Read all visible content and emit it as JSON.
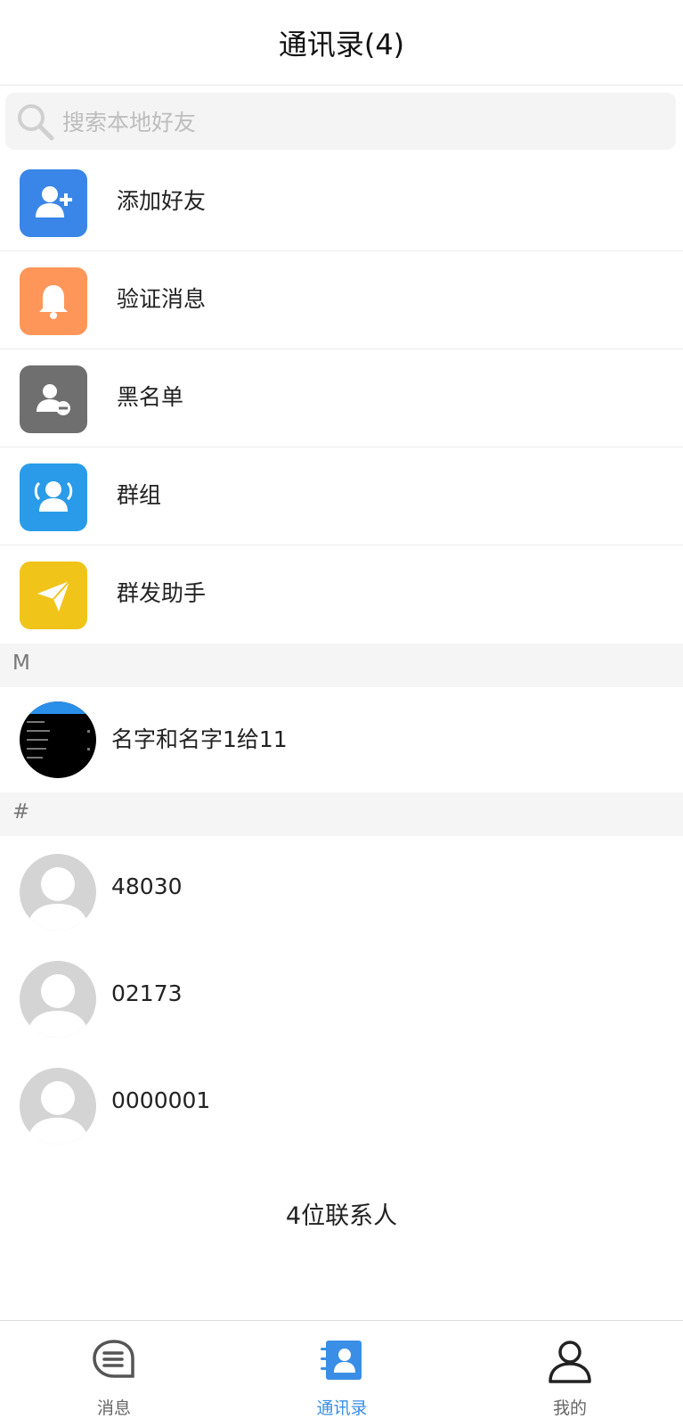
{
  "header": {
    "title": "通讯录(4)"
  },
  "search": {
    "placeholder": "搜索本地好友"
  },
  "menu": [
    {
      "label": "添加好友",
      "icon": "add-friend-icon",
      "color": "#3a86e8"
    },
    {
      "label": "验证消息",
      "icon": "bell-icon",
      "color": "#ff9659"
    },
    {
      "label": "黑名单",
      "icon": "blacklist-icon",
      "color": "#6f6f6f"
    },
    {
      "label": "群组",
      "icon": "group-icon",
      "color": "#2a9be8"
    },
    {
      "label": "群发助手",
      "icon": "paper-plane-icon",
      "color": "#f0c419"
    }
  ],
  "sections": [
    {
      "letter": "M",
      "contacts": [
        {
          "name": "名字和名字1给11"
        }
      ]
    },
    {
      "letter": "#",
      "contacts": [
        {
          "name": "48030"
        },
        {
          "name": "02173"
        },
        {
          "name": "0000001"
        }
      ]
    }
  ],
  "footer": {
    "count_text": "4位联系人"
  },
  "tabbar": {
    "tabs": [
      {
        "label": "消息",
        "icon": "message-icon",
        "active": false
      },
      {
        "label": "通讯录",
        "icon": "contacts-icon",
        "active": true
      },
      {
        "label": "我的",
        "icon": "profile-icon",
        "active": false
      }
    ],
    "active_color": "#3a8ee6"
  }
}
